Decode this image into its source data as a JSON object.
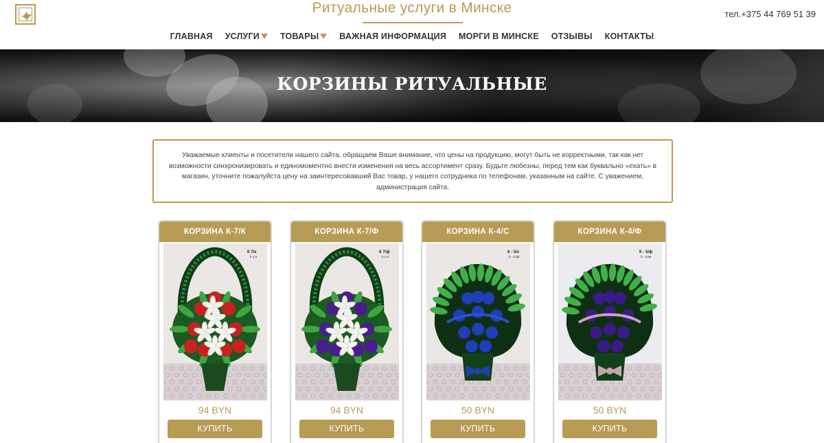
{
  "header": {
    "site_title": "Ритуальные услуги в Минске",
    "phone": "тел.+375 44 769 51 39",
    "logo_icon": "dove-icon"
  },
  "nav": [
    {
      "label": "ГЛАВНАЯ",
      "dropdown": false
    },
    {
      "label": "УСЛУГИ",
      "dropdown": true
    },
    {
      "label": "ТОВАРЫ",
      "dropdown": true
    },
    {
      "label": "ВАЖНАЯ ИНФОРМАЦИЯ",
      "dropdown": false
    },
    {
      "label": "МОРГИ В МИНСКЕ",
      "dropdown": false
    },
    {
      "label": "ОТЗЫВЫ",
      "dropdown": false
    },
    {
      "label": "КОНТАКТЫ",
      "dropdown": false
    }
  ],
  "hero": {
    "title": "КОРЗИНЫ РИТУАЛЬНЫЕ"
  },
  "notice": {
    "text": "Уважаемые клиенты и посетители нашего сайта, обращаем Ваше внимание, что цены на продукцию, могут быть не корректными, так как нет возможности синхронизировать и единомоментно внести изменения на весь ассортимент сразу. Будьте любезны, перед тем как буквально «ехать» в магазин, уточните пожалуйста цену на заинтересовавший Вас товар, у нашего сотрудника по телефонам, указанным на сайте. С уважением, администрация сайта."
  },
  "products": [
    {
      "title": "КОРЗИНА К-7/К",
      "price": "94 BYN",
      "button": "КУПИТЬ",
      "tag": "К 7/к",
      "tag_h": "h 1.0",
      "flower_main": "#c8211f",
      "flower_alt": "#f4f4ee",
      "shape": "handle"
    },
    {
      "title": "КОРЗИНА К-7/Ф",
      "price": "94 BYN",
      "button": "КУПИТЬ",
      "tag": "К 7/ф",
      "tag_h": "h 1.0",
      "flower_main": "#4a1d8f",
      "flower_alt": "#f4f4ee",
      "shape": "handle"
    },
    {
      "title": "КОРЗИНА К-4/С",
      "price": "50 BYN",
      "button": "КУПИТЬ",
      "tag": "К - 5/с",
      "tag_h": "h - 0.85",
      "flower_main": "#1d3fb8",
      "flower_alt": "#1a7a2c",
      "shape": "fan"
    },
    {
      "title": "КОРЗИНА К-4/Ф",
      "price": "50 BYN",
      "button": "КУПИТЬ",
      "tag": "К - 5/ф",
      "tag_h": "h - 0.85",
      "flower_main": "#3a1a86",
      "flower_alt": "#c9a4b0",
      "shape": "fan"
    }
  ],
  "colors": {
    "accent": "#b89b55",
    "text": "#333333"
  }
}
